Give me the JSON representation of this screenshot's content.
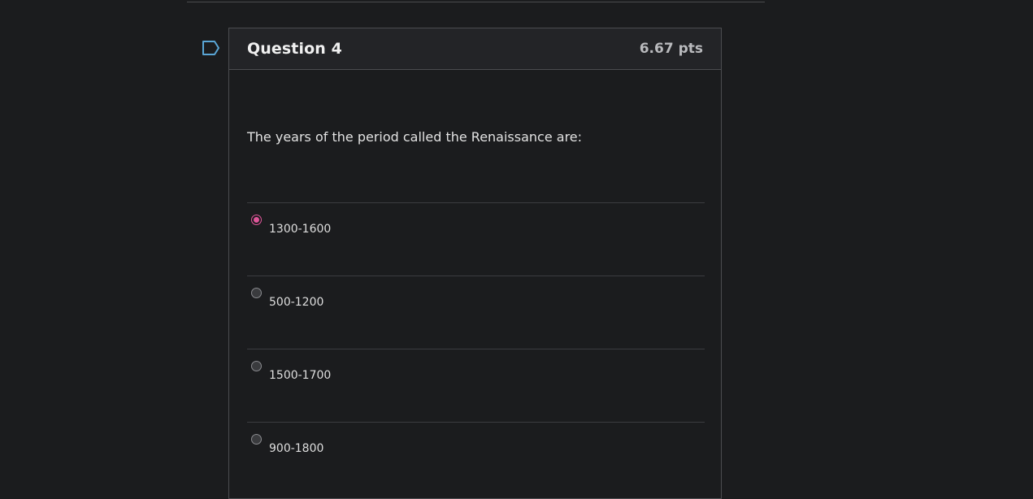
{
  "question": {
    "title": "Question 4",
    "points": "6.67 pts",
    "text": "The years of the period called the Renaissance are:",
    "flag_icon": "bookmark-flag-icon",
    "accent_color": "#e0569a",
    "answers": [
      {
        "label": "1300-1600",
        "selected": true
      },
      {
        "label": "500-1200",
        "selected": false
      },
      {
        "label": "1500-1700",
        "selected": false
      },
      {
        "label": "900-1800",
        "selected": false
      }
    ]
  }
}
